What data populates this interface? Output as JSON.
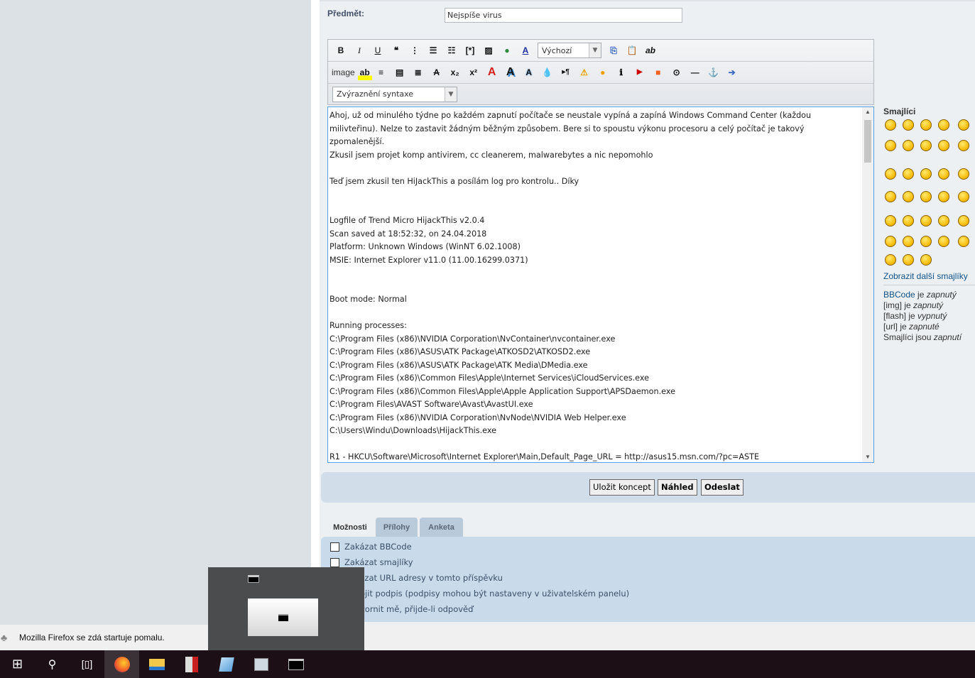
{
  "subject": {
    "label": "Předmět:",
    "value": "Nejspíše virus"
  },
  "toolbar": {
    "row1": [
      "B",
      "I",
      "U",
      "quote-icon",
      "code-icon",
      "list-icon",
      "ordered-list-icon",
      "list-item-icon",
      "image-icon",
      "link-icon",
      "font-color-icon"
    ],
    "font_select": "Výchozí",
    "row1b": [
      "copy-icon",
      "paste-icon",
      "spellcheck-icon"
    ],
    "spell_label": "ab",
    "image_label": "image",
    "syntax_select": "Zvýraznění syntaxe"
  },
  "editor": {
    "lines": [
      "Ahoj, už od minulého týdne po každém zapnutí počítače se neustale vypíná a zapíná Windows Command Center (každou",
      "milivteřinu). Nelze to zastavit žádným běžným způsobem. Bere si to spoustu výkonu procesoru a celý počítač je takový",
      "zpomalenější.",
      "Zkusil jsem projet komp antivirem, cc cleanerem, malwarebytes a nic nepomohlo",
      "",
      "Teď jsem zkusil ten HiJackThis a posílám log pro kontrolu.. Díky",
      "",
      "",
      "Logfile of Trend Micro HijackThis v2.0.4",
      "Scan saved at 18:52:32, on 24.04.2018",
      "Platform: Unknown Windows (WinNT 6.02.1008)",
      "MSIE: Internet Explorer v11.0 (11.00.16299.0371)",
      "",
      "",
      "Boot mode: Normal",
      "",
      "Running processes:",
      "C:\\Program Files (x86)\\NVIDIA Corporation\\NvContainer\\nvcontainer.exe",
      "C:\\Program Files (x86)\\ASUS\\ATK Package\\ATKOSD2\\ATKOSD2.exe",
      "C:\\Program Files (x86)\\ASUS\\ATK Package\\ATK Media\\DMedia.exe",
      "C:\\Program Files (x86)\\Common Files\\Apple\\Internet Services\\iCloudServices.exe",
      "C:\\Program Files (x86)\\Common Files\\Apple\\Apple Application Support\\APSDaemon.exe",
      "C:\\Program Files\\AVAST Software\\Avast\\AvastUI.exe",
      "C:\\Program Files (x86)\\NVIDIA Corporation\\NvNode\\NVIDIA Web Helper.exe",
      "C:\\Users\\Windu\\Downloads\\HijackThis.exe",
      "",
      "R1 - HKCU\\Software\\Microsoft\\Internet Explorer\\Main,Default_Page_URL = http://asus15.msn.com/?pc=ASTE"
    ]
  },
  "smilies": {
    "title": "Smajlíci",
    "more_link": "Zobrazit další smajlíky",
    "status": [
      {
        "a": "BBCode",
        "b": " je ",
        "c": "zapnutý"
      },
      {
        "a": "[img]",
        "b": " je ",
        "c": "zapnutý"
      },
      {
        "a": "[flash]",
        "b": " je ",
        "c": "vypnutý"
      },
      {
        "a": "[url]",
        "b": " je ",
        "c": "zapnuté"
      },
      {
        "a": "Smajlíci",
        "b": " jsou ",
        "c": "zapnutí"
      }
    ]
  },
  "buttons": {
    "save_draft": "Uložit koncept",
    "preview": "Náhled",
    "submit": "Odeslat"
  },
  "tabs": [
    "Možnosti",
    "Přílohy",
    "Anketa"
  ],
  "options": [
    "Zakázat BBCode",
    "Zakázat smajlíky",
    "Zakázat URL adresy v tomto příspěvku",
    "Připojit podpis (podpisy mohou být nastaveny v uživatelském panelu)",
    "Upozornit mě, přijde-li odpověď"
  ],
  "notification": "Mozilla Firefox se zdá startuje pomalu.",
  "taskbar": [
    "start-icon",
    "search-icon",
    "task-view-icon",
    "firefox-icon",
    "file-explorer-icon",
    "app-icon",
    "notepad-icon",
    "resource-monitor-icon",
    "command-prompt-icon"
  ]
}
